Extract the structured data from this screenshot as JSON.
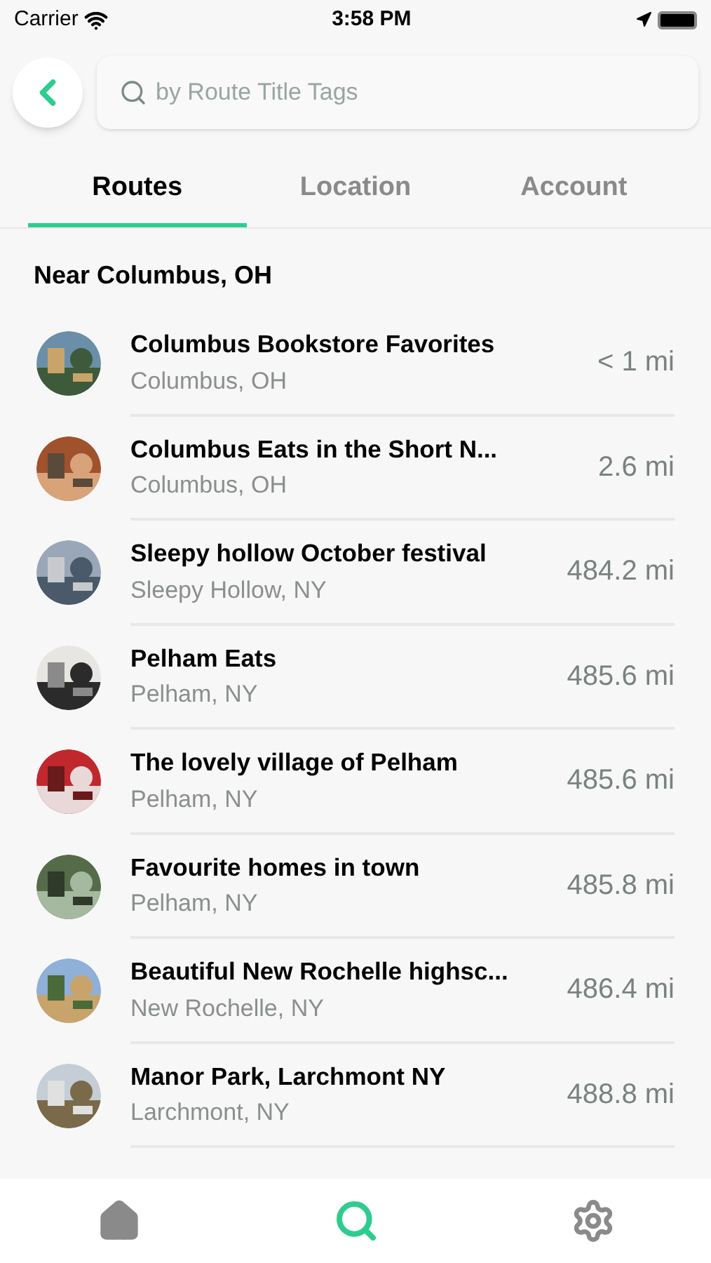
{
  "status_bar": {
    "carrier": "Carrier",
    "time": "3:58 PM"
  },
  "search": {
    "placeholder": "by Route Title Tags"
  },
  "tabs": [
    {
      "label": "Routes",
      "selected": true
    },
    {
      "label": "Location",
      "selected": false
    },
    {
      "label": "Account",
      "selected": false
    }
  ],
  "section_title": "Near Columbus, OH",
  "routes": [
    {
      "title": "Columbus Bookstore Favorites",
      "place": "Columbus, OH",
      "distance": "< 1 mi"
    },
    {
      "title": "Columbus Eats in the Short N...",
      "place": "Columbus, OH",
      "distance": "2.6 mi"
    },
    {
      "title": "Sleepy hollow October festival",
      "place": "Sleepy Hollow, NY",
      "distance": "484.2 mi"
    },
    {
      "title": "Pelham Eats",
      "place": "Pelham, NY",
      "distance": "485.6 mi"
    },
    {
      "title": "The lovely village of Pelham",
      "place": "Pelham, NY",
      "distance": "485.6 mi"
    },
    {
      "title": "Favourite homes in town",
      "place": "Pelham, NY",
      "distance": "485.8 mi"
    },
    {
      "title": "Beautiful New Rochelle highsc...",
      "place": "New Rochelle, NY",
      "distance": "486.4 mi"
    },
    {
      "title": "Manor Park, Larchmont NY",
      "place": "Larchmont, NY",
      "distance": "488.8 mi"
    }
  ],
  "nav": [
    {
      "kind": "home",
      "selected": false
    },
    {
      "kind": "search",
      "selected": true
    },
    {
      "kind": "settings",
      "selected": false
    }
  ]
}
